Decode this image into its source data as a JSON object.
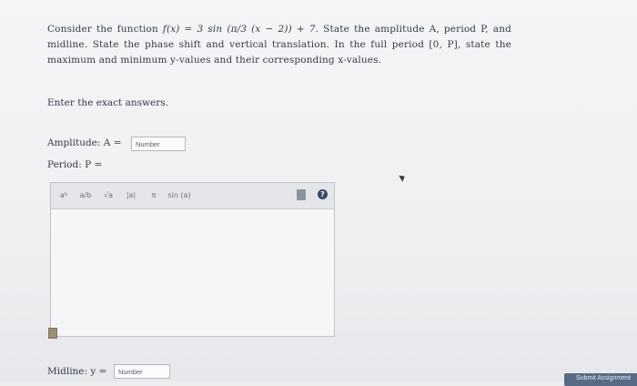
{
  "question": {
    "part1": "Consider the function ",
    "function": "f(x) = 3 sin (π/3 (x − 2)) + 7.",
    "part2": " State the amplitude A, period P, and midline. State the phase shift and vertical translation. In the full period [0, P], state the maximum and minimum y-values and their corresponding x-values."
  },
  "instructions": "Enter the exact answers.",
  "amplitude": {
    "label": "Amplitude: A =",
    "placeholder": "Number"
  },
  "period": {
    "label": "Period: P ="
  },
  "toolbar": {
    "power": "aᵇ",
    "fraction": "a/b",
    "sqrt": "√a",
    "abs": "|a|",
    "pi": "π",
    "sin": "sin (a)"
  },
  "midline": {
    "label": "Midline: y =",
    "placeholder": "Number"
  },
  "submit": {
    "label": "Submit Assignment"
  }
}
